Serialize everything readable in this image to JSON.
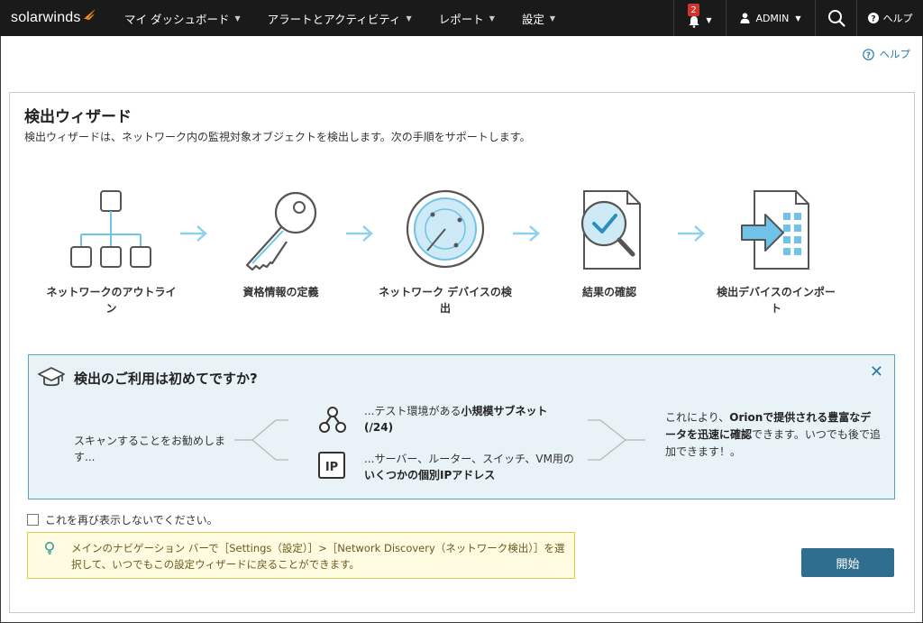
{
  "nav": {
    "logo": "solarwinds",
    "menu": [
      {
        "label": "マイ ダッシュボード"
      },
      {
        "label": "アラートとアクティビティ"
      },
      {
        "label": "レポート"
      },
      {
        "label": "設定"
      }
    ],
    "notification_count": "2",
    "user": "ADMIN",
    "help": "ヘルプ"
  },
  "page_help": "ヘルプ",
  "wizard": {
    "title": "検出ウィザード",
    "description": "検出ウィザードは、ネットワーク内の監視対象オブジェクトを検出します。次の手順をサポートします。",
    "steps": [
      {
        "label": "ネットワークのアウトライン",
        "icon": "network-outline-icon"
      },
      {
        "label": "資格情報の定義",
        "icon": "key-icon"
      },
      {
        "label": "ネットワーク デバイスの検出",
        "icon": "radar-icon"
      },
      {
        "label": "結果の確認",
        "icon": "review-results-icon"
      },
      {
        "label": "検出デバイスのインポート",
        "icon": "import-devices-icon"
      }
    ]
  },
  "info": {
    "title": "検出のご利用は初めてですか?",
    "left_text": "スキャンすることをお勧めします...",
    "option1_pre": "...テスト環境がある",
    "option1_bold": "小規模サブネット (/24)",
    "option2_pre": "...サーバー、ルーター、スイッチ、VM用の",
    "option2_bold": "いくつかの個別IPアドレス",
    "right_pre": "これにより、",
    "right_bold1": "Orionで提供される豊富なデータを迅速に確認",
    "right_post": "できます。いつでも後で追加できます！。"
  },
  "checkbox_label": "これを再び表示しないでください。",
  "notice": "メインのナビゲーション バーで［Settings（設定）］>［Network Discovery（ネットワーク検出）］を選択して、いつでもこの設定ウィザードに戻ることができます。",
  "start_button": "開始",
  "colors": {
    "nav_bg": "#1a1a1a",
    "accent": "#2f6e8e",
    "info_bg": "#e8f2f7",
    "notice_bg": "#fffbe0",
    "badge": "#d0342c"
  }
}
